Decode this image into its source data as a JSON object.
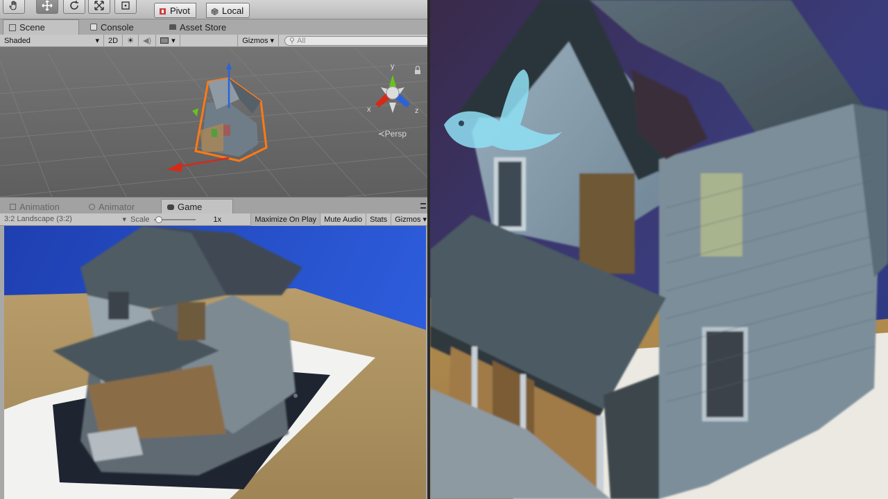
{
  "toolbar": {
    "tools": [
      "hand-tool",
      "move-tool",
      "rotate-tool",
      "scale-tool",
      "rect-tool"
    ],
    "pivot_label": "Pivot",
    "local_label": "Local"
  },
  "tabs": {
    "scene": "Scene",
    "console": "Console",
    "asset_store": "Asset Store"
  },
  "scene_toolbar": {
    "shading": "Shaded",
    "mode_2d": "2D",
    "gizmos": "Gizmos",
    "search_placeholder": "All"
  },
  "scene": {
    "persp_label": "Persp",
    "axis_x": "x",
    "axis_y": "y",
    "axis_z": "z"
  },
  "game_tabs": {
    "animation": "Animation",
    "animator": "Animator",
    "game": "Game"
  },
  "game_toolbar": {
    "aspect": "3:2 Landscape (3:2)",
    "scale_label": "Scale",
    "scale_value": "1x",
    "maximize": "Maximize On Play",
    "mute": "Mute Audio",
    "stats": "Stats",
    "gizmos": "Gizmos"
  },
  "colors": {
    "selection": "#ff7a14",
    "axis_x": "#d42a1a",
    "axis_y": "#66c41a",
    "axis_z": "#2a63d8",
    "game_bg": "#2a47b8"
  }
}
